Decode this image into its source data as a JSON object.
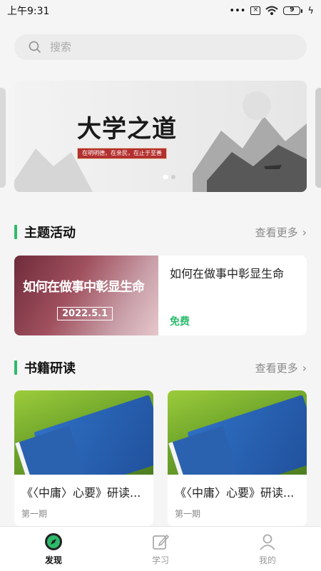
{
  "status_bar": {
    "time": "上午9:31",
    "battery": "9"
  },
  "search": {
    "placeholder": "搜索"
  },
  "banner": {
    "title": "大学之道",
    "subtitle": "在明明德，在亲民，在止于至善",
    "page_count": 2,
    "active_page": 1
  },
  "activities": {
    "title": "主题活动",
    "more_label": "查看更多",
    "items": [
      {
        "cover_text": "如何在做事中彰显生命",
        "cover_date": "2022.5.1",
        "name": "如何在做事中彰显生命",
        "price": "免费"
      }
    ]
  },
  "books": {
    "title": "书籍研读",
    "more_label": "查看更多",
    "items": [
      {
        "title": "《〈中庸〉心要》研读...",
        "issue": "第一期"
      },
      {
        "title": "《〈中庸〉心要》研读...",
        "issue": "第一期"
      }
    ]
  },
  "tabbar": {
    "tabs": [
      {
        "label": "发现",
        "icon": "compass-icon",
        "active": true
      },
      {
        "label": "学习",
        "icon": "edit-icon",
        "active": false
      },
      {
        "label": "我的",
        "icon": "user-icon",
        "active": false
      }
    ]
  },
  "colors": {
    "accent": "#2dbb6b",
    "banner_seal": "#b3302e"
  }
}
